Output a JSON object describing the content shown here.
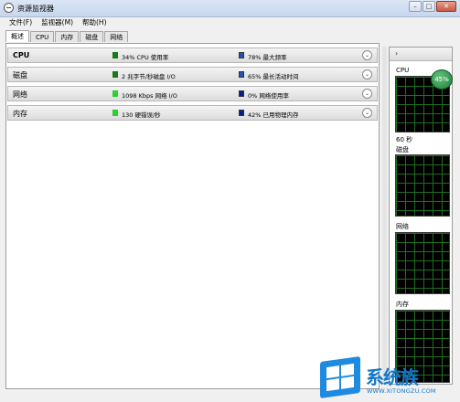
{
  "window": {
    "title": "资源监视器",
    "buttons": {
      "minimize": "–",
      "maximize": "□",
      "close": "✕"
    }
  },
  "menu": [
    "文件(F)",
    "监视器(M)",
    "帮助(H)"
  ],
  "tabs": [
    "概述",
    "CPU",
    "内存",
    "磁盘",
    "网络"
  ],
  "sections": [
    {
      "name": "CPU",
      "stat1": "34% CPU 使用率",
      "stat2": "78% 最大频率",
      "color1": "#1a7a1a",
      "color2": "#2a4fb0"
    },
    {
      "name": "磁盘",
      "stat1": "2 兆字节/秒磁盘 I/O",
      "stat2": "65% 最长活动时间",
      "color1": "#1a7a1a",
      "color2": "#2a4fb0"
    },
    {
      "name": "网络",
      "stat1": "1098 Kbps 网络 I/O",
      "stat2": "0% 网络使用率",
      "color1": "#2fcf2f",
      "color2": "#00208a"
    },
    {
      "name": "内存",
      "stat1": "130 硬错误/秒",
      "stat2": "42% 已用物理内存",
      "color1": "#2fcf2f",
      "color2": "#00208a"
    }
  ],
  "right_panel": {
    "cpu_label": "CPU",
    "cpu_badge": "45%",
    "time_label": "60 秒",
    "disk_label": "磁盘",
    "net_label": "网络",
    "mem_label": "内存"
  },
  "watermark": {
    "brand": "系统族",
    "url": "WWW.XITONGZU.COM"
  }
}
